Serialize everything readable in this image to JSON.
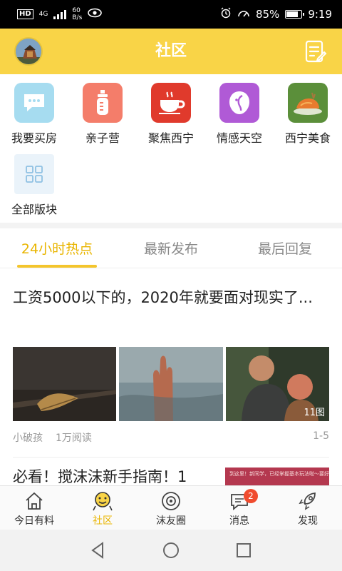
{
  "status_bar": {
    "network_tag": "HD",
    "network_type": "4G",
    "speed_value": "60",
    "speed_unit": "B/s",
    "battery": "85%",
    "battery_level": 0.85,
    "time": "9:19"
  },
  "header": {
    "title": "社区"
  },
  "categories": [
    {
      "label": "我要买房",
      "icon": "chat-bubble-icon",
      "color": "#a6dcf0"
    },
    {
      "label": "亲子营",
      "icon": "baby-bottle-icon",
      "color": "#f47d6a"
    },
    {
      "label": "聚焦西宁",
      "icon": "coffee-cup-icon",
      "color": "#e03a2c"
    },
    {
      "label": "情感天空",
      "icon": "heart-face-icon",
      "color": "#b05ad6"
    },
    {
      "label": "西宁美食",
      "icon": "roast-food-icon",
      "color": "#5b8f3a"
    },
    {
      "label": "全部版块",
      "icon": "grid-icon",
      "color": "#eaf3fa"
    }
  ],
  "tabs": [
    {
      "label": "24小时热点",
      "active": true
    },
    {
      "label": "最新发布",
      "active": false
    },
    {
      "label": "最后回复",
      "active": false
    }
  ],
  "posts": [
    {
      "title": "工资5000以下的，2020年就要面对现实了...",
      "image_count": "11图",
      "author": "小破孩",
      "views": "1万阅读",
      "pages": "1-5"
    },
    {
      "title": "必看！搅沫沫新手指南！1",
      "thumb_text": "到这里！新同学，已经掌握基本玩法啦～要好好学起来"
    }
  ],
  "tabbar": [
    {
      "label": "今日有料",
      "icon": "home-icon",
      "active": false
    },
    {
      "label": "社区",
      "icon": "community-face-icon",
      "active": true
    },
    {
      "label": "沫友圈",
      "icon": "friends-circle-icon",
      "active": false
    },
    {
      "label": "消息",
      "icon": "message-icon",
      "active": false,
      "badge": "2"
    },
    {
      "label": "发现",
      "icon": "rocket-icon",
      "active": false
    }
  ],
  "colors": {
    "accent": "#f9d447",
    "accent_text": "#e9b500",
    "badge": "#f04b2e"
  }
}
